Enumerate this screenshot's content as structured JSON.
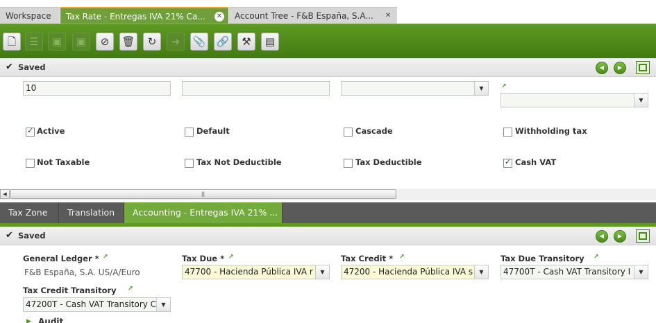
{
  "top_tabs": [
    {
      "label": "Workspace"
    },
    {
      "label": "Tax Rate - Entregas IVA 21% Ca..."
    },
    {
      "label": "Account Tree - F&B España, S.A..."
    }
  ],
  "toolbar": {
    "buttons": [
      "new-document",
      "new-record",
      "save",
      "save-close",
      "undo",
      "delete",
      "refresh",
      "export",
      "attach",
      "link",
      "tools",
      "grid-view"
    ]
  },
  "status_top": {
    "text": "Saved"
  },
  "upper_form": {
    "field1_value": "10",
    "field2_value": "",
    "field3_value": "",
    "field4_value": "",
    "checkboxes": [
      {
        "label": "Active",
        "checked": true
      },
      {
        "label": "Default",
        "checked": false
      },
      {
        "label": "Cascade",
        "checked": false
      },
      {
        "label": "Withholding tax",
        "checked": false
      },
      {
        "label": "Not Taxable",
        "checked": false
      },
      {
        "label": "Tax Not Deductible",
        "checked": false
      },
      {
        "label": "Tax Deductible",
        "checked": false
      },
      {
        "label": "Cash VAT",
        "checked": true
      }
    ]
  },
  "sub_tabs": [
    {
      "label": "Tax Zone"
    },
    {
      "label": "Translation"
    },
    {
      "label": "Accounting - Entregas IVA 21% ..."
    }
  ],
  "status_bottom": {
    "text": "Saved"
  },
  "lower_form": {
    "general_ledger": {
      "label": "General Ledger *",
      "value": "F&B España, S.A. US/A/Euro"
    },
    "tax_due": {
      "label": "Tax Due *",
      "value": "47700 - Hacienda Pública IVA r"
    },
    "tax_credit": {
      "label": "Tax Credit *",
      "value": "47200 - Hacienda Pública IVA s"
    },
    "tax_due_transitory": {
      "label": "Tax Due Transitory",
      "value": "47700T - Cash VAT Transitory I"
    },
    "tax_credit_transitory": {
      "label": "Tax Credit Transitory",
      "value": "47200T - Cash VAT Transitory C"
    },
    "audit": {
      "label": "Audit"
    }
  },
  "colors": {
    "accent_green": "#5e9a22",
    "active_tab": "#6f9f3a",
    "active_tab_marker": "#f3a32a",
    "subtab_bar": "#5a5a5a",
    "required_field": "#fbfbd8"
  }
}
